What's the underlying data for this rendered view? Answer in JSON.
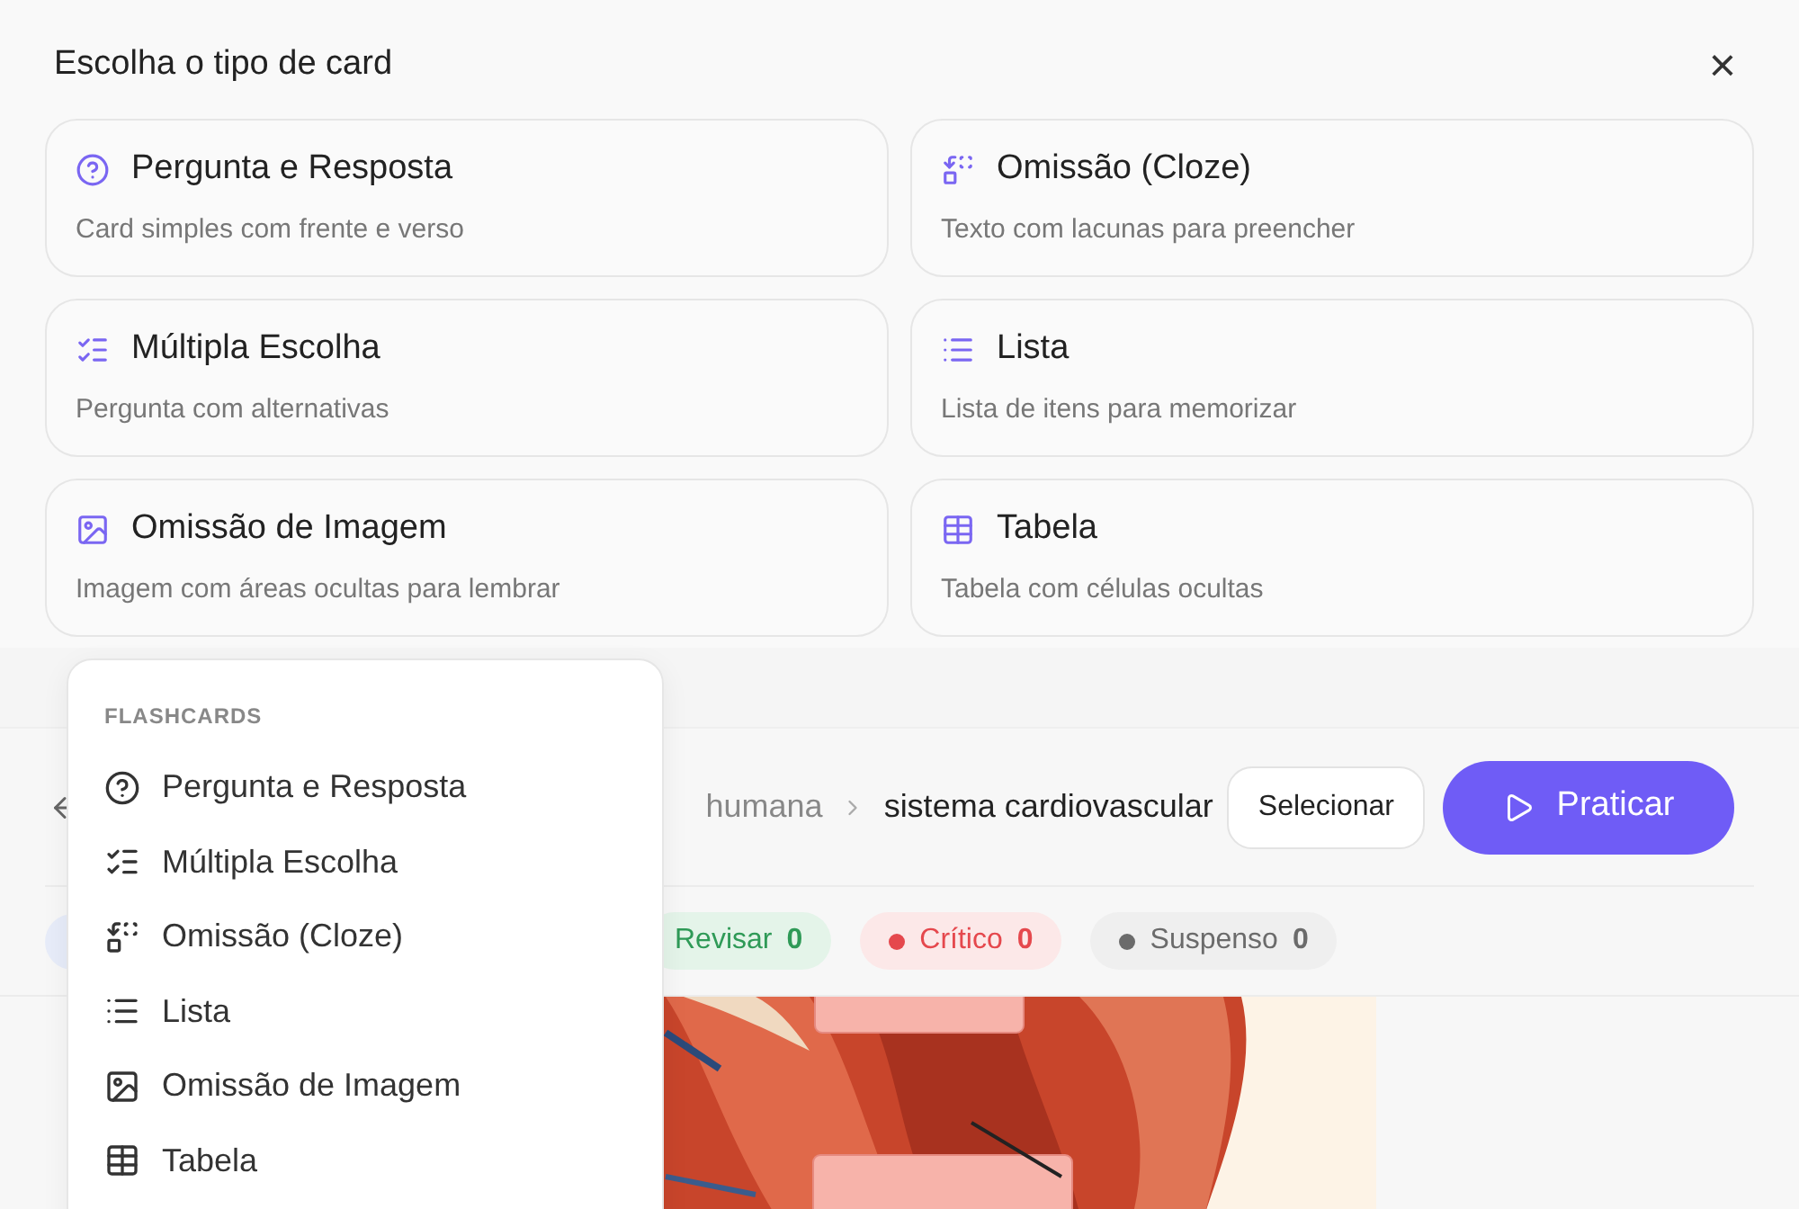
{
  "dialog": {
    "title": "Escolha o tipo de card",
    "close": "×",
    "options": [
      {
        "kind": "qa",
        "title": "Pergunta e Resposta",
        "description": "Card simples com frente e verso"
      },
      {
        "kind": "cloze",
        "title": "Omissão (Cloze)",
        "description": "Texto com lacunas para preencher"
      },
      {
        "kind": "multiple_choice",
        "title": "Múltipla Escolha",
        "description": "Pergunta com alternativas"
      },
      {
        "kind": "list",
        "title": "Lista",
        "description": "Lista de itens para memorizar"
      },
      {
        "kind": "image_occlusion",
        "title": "Omissão de Imagem",
        "description": "Imagem com áreas ocultas para lembrar"
      },
      {
        "kind": "table",
        "title": "Tabela",
        "description": "Tabela com células ocultas"
      }
    ]
  },
  "header": {
    "breadcrumb": [
      "humana",
      "sistema cardiovascular"
    ],
    "select_button": "Selecionar",
    "practice_button": "Praticar"
  },
  "filters": [
    {
      "label": "Revisar",
      "count": "0",
      "color": "#2f9a57",
      "dot": false
    },
    {
      "label": "Crítico",
      "count": "0",
      "color": "#e5484d",
      "dot": true
    },
    {
      "label": "Suspenso",
      "count": "0",
      "color": "#6b6b6b",
      "dot": true
    }
  ],
  "menu": {
    "heading": "FLASHCARDS",
    "items": [
      {
        "kind": "qa",
        "label": "Pergunta e Resposta"
      },
      {
        "kind": "multiple_choice",
        "label": "Múltipla Escolha"
      },
      {
        "kind": "cloze",
        "label": "Omissão (Cloze)"
      },
      {
        "kind": "list",
        "label": "Lista"
      },
      {
        "kind": "image_occlusion",
        "label": "Omissão de Imagem"
      },
      {
        "kind": "table",
        "label": "Tabela"
      }
    ]
  }
}
